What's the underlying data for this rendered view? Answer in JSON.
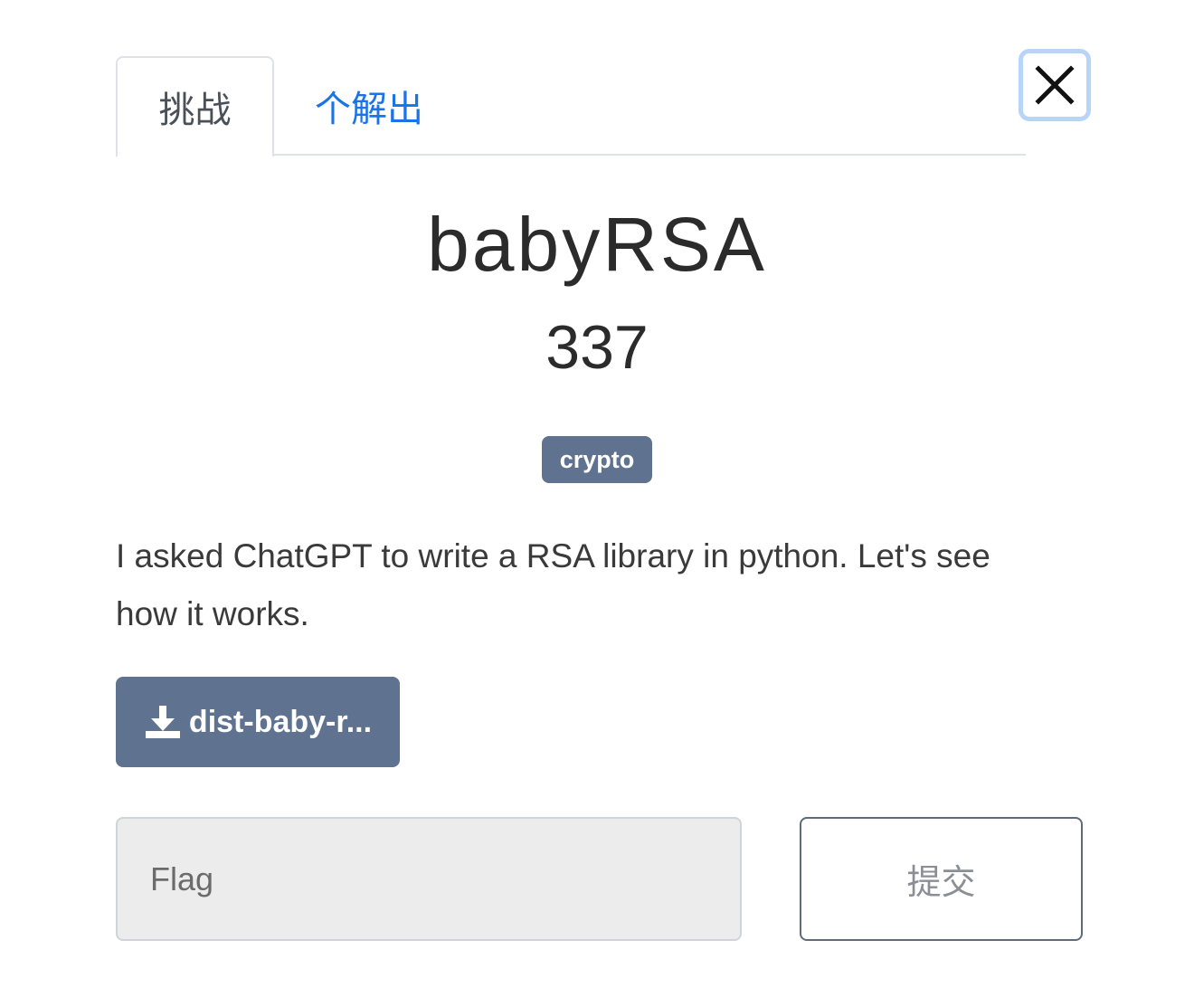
{
  "tabs": {
    "challenge": "挑战",
    "solves": "个解出"
  },
  "close_icon": "close-icon",
  "challenge": {
    "name": "babyRSA",
    "points": "337",
    "tag": "crypto",
    "description": "I asked ChatGPT to write a RSA library in python. Let's see how it works."
  },
  "file": {
    "icon": "download-icon",
    "label": "dist-baby-r..."
  },
  "form": {
    "flag_placeholder": "Flag",
    "flag_value": "",
    "submit_label": "提交"
  },
  "colors": {
    "badge_bg": "#5f7290",
    "link": "#1a73e8",
    "focus_ring": "#b8d4f8"
  }
}
